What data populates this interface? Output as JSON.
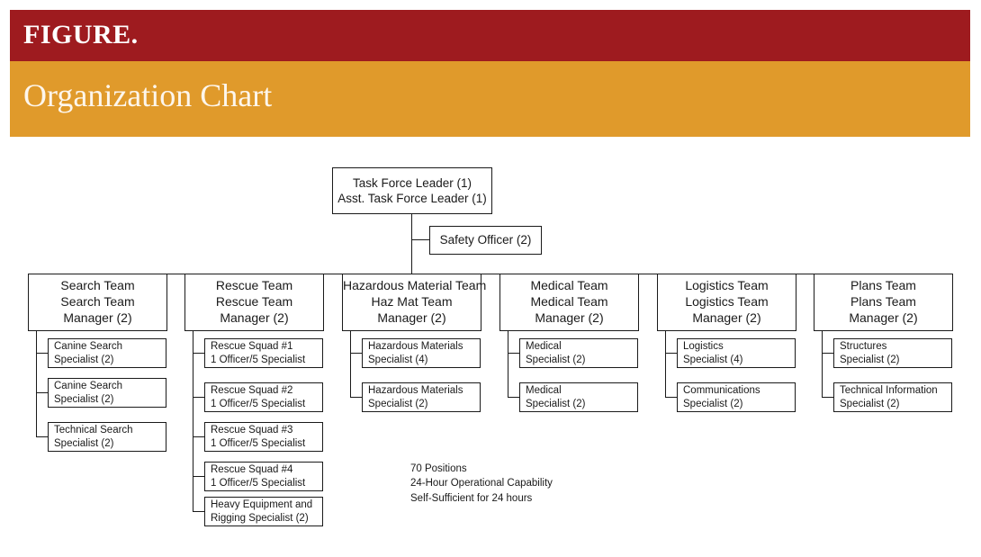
{
  "banner": {
    "figure_label": "FIGURE.",
    "title": "Organization Chart",
    "red_color": "#9e1b1f",
    "orange_color": "#e09a2b"
  },
  "chart_data": {
    "type": "diagram",
    "title": "Organization Chart",
    "root": {
      "line1": "Task Force Leader (1)",
      "line2": "Asst. Task Force Leader (1)"
    },
    "staff": {
      "label": "Safety Officer (2)"
    },
    "teams": [
      {
        "line1": "Search Team",
        "line2": "Search Team",
        "line3": "Manager (2)",
        "children": [
          {
            "line1": "Canine Search",
            "line2": "Specialist (2)"
          },
          {
            "line1": "Canine Search",
            "line2": "Specialist (2)"
          },
          {
            "line1": "Technical Search",
            "line2": "Specialist (2)"
          }
        ]
      },
      {
        "line1": "Rescue Team",
        "line2": "Rescue Team",
        "line3": "Manager (2)",
        "children": [
          {
            "line1": "Rescue Squad #1",
            "line2": "1 Officer/5 Specialist"
          },
          {
            "line1": "Rescue Squad #2",
            "line2": "1 Officer/5 Specialist"
          },
          {
            "line1": "Rescue Squad #3",
            "line2": "1 Officer/5 Specialist"
          },
          {
            "line1": "Rescue Squad #4",
            "line2": "1 Officer/5 Specialist"
          },
          {
            "line1": "Heavy Equipment and",
            "line2": "Rigging Specialist (2)"
          }
        ]
      },
      {
        "line1": "Hazardous Material Team",
        "line2": "Haz Mat Team",
        "line3": "Manager (2)",
        "children": [
          {
            "line1": "Hazardous Materials",
            "line2": "Specialist (4)"
          },
          {
            "line1": "Hazardous Materials",
            "line2": "Specialist (2)"
          }
        ]
      },
      {
        "line1": "Medical Team",
        "line2": "Medical Team",
        "line3": "Manager (2)",
        "children": [
          {
            "line1": "Medical",
            "line2": "Specialist (2)"
          },
          {
            "line1": "Medical",
            "line2": "Specialist (2)"
          }
        ]
      },
      {
        "line1": "Logistics Team",
        "line2": "Logistics Team",
        "line3": "Manager (2)",
        "children": [
          {
            "line1": "Logistics",
            "line2": "Specialist (4)"
          },
          {
            "line1": "Communications",
            "line2": "Specialist (2)"
          }
        ]
      },
      {
        "line1": "Plans Team",
        "line2": "Plans Team",
        "line3": "Manager (2)",
        "children": [
          {
            "line1": "Structures",
            "line2": "Specialist (2)"
          },
          {
            "line1": "Technical Information",
            "line2": "Specialist (2)"
          }
        ]
      }
    ],
    "notes": [
      "70 Positions",
      "24-Hour Operational Capability",
      "Self-Sufficient for 24 hours"
    ]
  }
}
